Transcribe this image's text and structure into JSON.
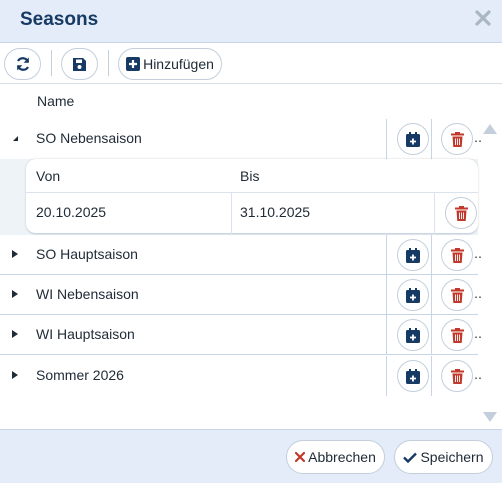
{
  "window": {
    "title": "Seasons"
  },
  "toolbar": {
    "add_label": "Hinzufügen"
  },
  "table": {
    "column_header": "Name",
    "expanded": {
      "name": "SO Nebensaison",
      "from_label": "Von",
      "to_label": "Bis",
      "from_value": "20.10.2025",
      "to_value": "31.10.2025"
    },
    "rows": [
      {
        "name": "SO Hauptsaison"
      },
      {
        "name": "WI Nebensaison"
      },
      {
        "name": "WI Hauptsaison"
      },
      {
        "name": "Sommer 2026"
      }
    ],
    "overflow_dots": "‥"
  },
  "footer": {
    "cancel_label": "Abbrechen",
    "save_label": "Speichern"
  },
  "colors": {
    "header_bg": "#e3ecf8",
    "title": "#163a63",
    "add_icon": "#163a63",
    "delete_icon": "#c0392b",
    "cancel_icon": "#c0392b"
  }
}
